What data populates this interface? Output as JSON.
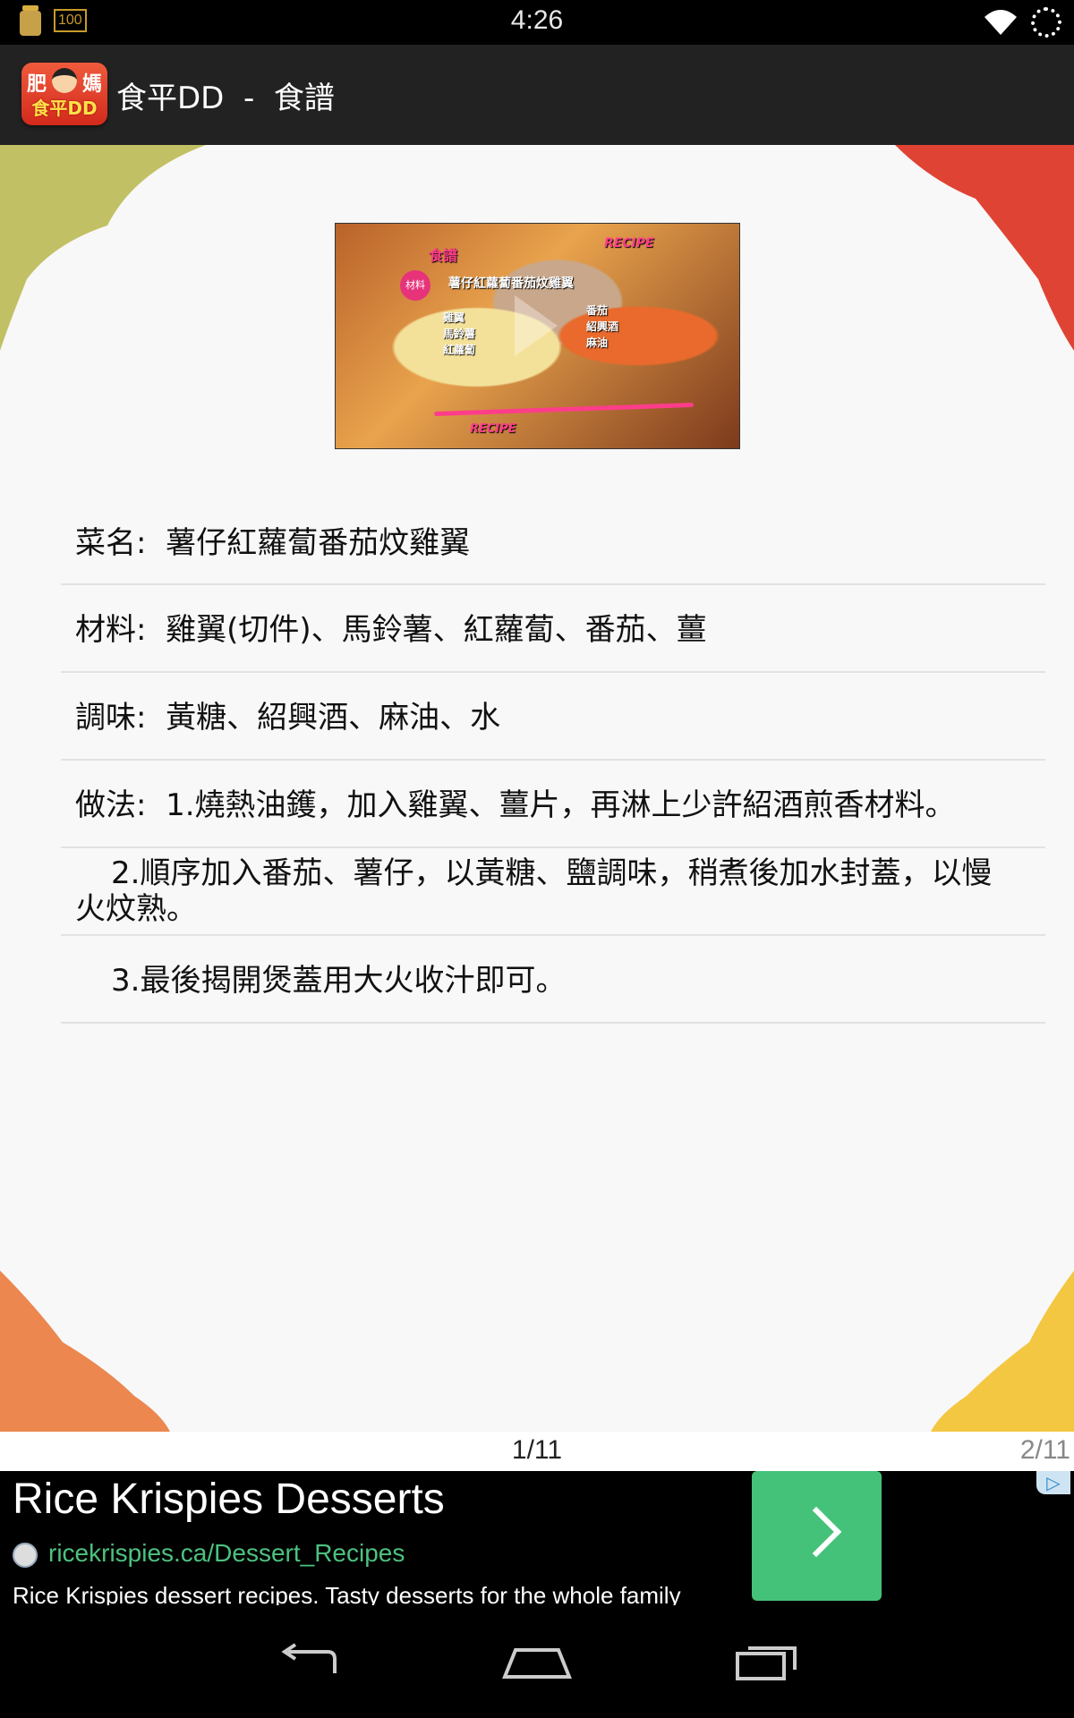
{
  "status_bar": {
    "time": "4:26",
    "battery_label": "100",
    "icons": [
      "jar-icon",
      "battery-icon",
      "wifi-icon",
      "loading-spinner-icon"
    ]
  },
  "action_bar": {
    "logo_text_top_left": "肥",
    "logo_text_top_right": "媽",
    "logo_text_bottom": "食平DD",
    "title": "食平DD  -  食譜"
  },
  "video": {
    "title_label": "食譜",
    "recipe_label": "RECIPE",
    "ingredients_badge": "材料",
    "dish_title": "薯仔紅蘿蔔番茄炆雞翼",
    "ingredients_left": [
      "雞翼",
      "馬鈴薯",
      "紅蘿蔔"
    ],
    "ingredients_right": [
      "番茄",
      "紹興酒",
      "麻油"
    ],
    "footer_label": "RECIPE"
  },
  "recipe": {
    "rows": [
      "菜名:  薯仔紅蘿蔔番茄炆雞翼",
      "材料:  雞翼(切件)、馬鈴薯、紅蘿蔔、番茄、薑",
      "調味:  黃糖、紹興酒、麻油、水",
      "做法:  1.燒熱油鑊，加入雞翼、薑片，再淋上少許紹酒煎香材料。",
      "2.順序加入番茄、薯仔，以黃糖、鹽調味，稍煮後加水封蓋，以慢火炆熟。",
      "3.最後揭開煲蓋用大火收汁即可。"
    ]
  },
  "pager": {
    "current": "1/11",
    "next": "2/11"
  },
  "ad": {
    "title": "Rice Krispies Desserts",
    "url": "ricekrispies.ca/Dessert_Recipes",
    "description": "Rice Krispies dessert recipes. Tasty desserts for the whole family"
  },
  "colors": {
    "action_bar_bg": "#222222",
    "ad_button": "#45c27a",
    "ad_url": "#4cc27f"
  }
}
